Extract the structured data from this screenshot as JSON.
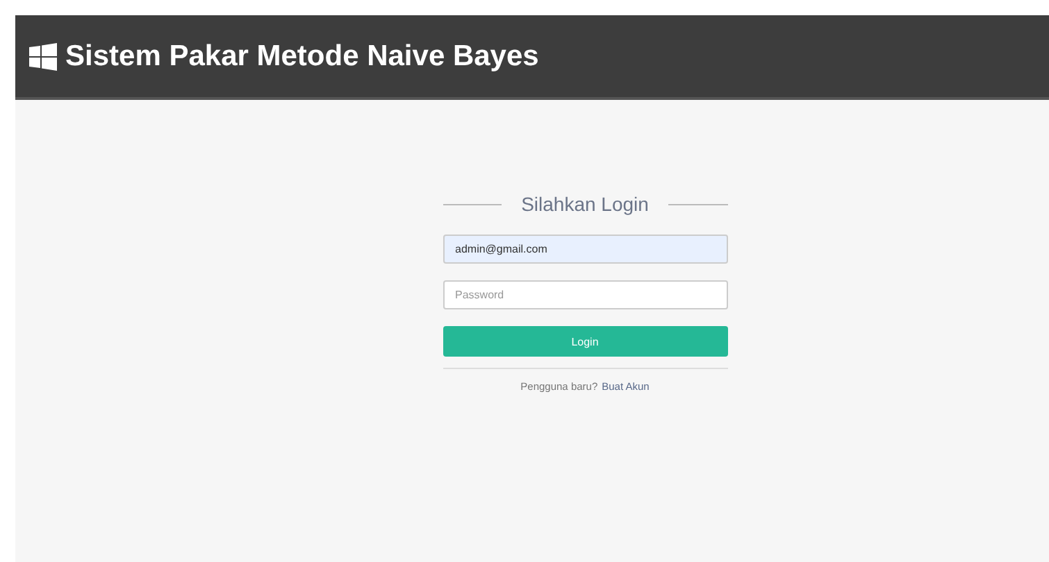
{
  "header": {
    "title": "Sistem Pakar Metode Naive Bayes"
  },
  "login": {
    "heading": "Silahkan Login",
    "email": {
      "value": "admin@gmail.com"
    },
    "password": {
      "placeholder": "Password"
    },
    "button": "Login",
    "signup_prompt": "Pengguna baru?",
    "signup_link": "Buat Akun"
  }
}
